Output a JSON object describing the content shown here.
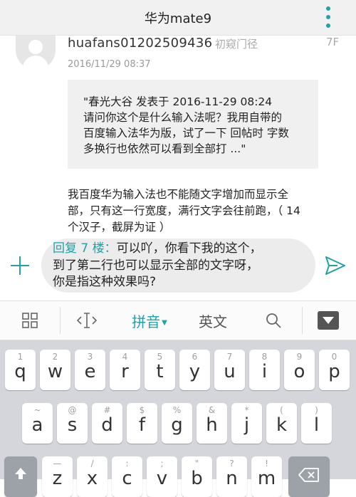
{
  "header": {
    "title": "华为mate9"
  },
  "post": {
    "username": "huafans01202509436",
    "user_level": "初窥门径",
    "floor": "7F",
    "datetime": "2016/11/29 08:37",
    "quote_lines": [
      "\"春光大谷 发表于 2016-11-29 08:24",
      "请问你这个是什么输入法呢？我用自带的",
      "百度输入法华为版，试了一下 回帖时 字数",
      "多换行也依然可以看到全部打 ...\""
    ],
    "body_lines": [
      "我百度华为输入法也不能随文字增加而显示全",
      "部，只有这一行宽度，满行文字会往前跑，（ 14",
      "个汉子，截屏为证 ）"
    ]
  },
  "reply": {
    "prefix": "回复 7 楼：",
    "line1": "可以吖，你看下我的这个，",
    "line2": "到了第二行也可以显示全部的文字呀，",
    "line3": "你是指这种效果吗?"
  },
  "ime_toolbar": {
    "pinyin_label": "拼音",
    "english_label": "英文"
  },
  "keyboard": {
    "row1": [
      {
        "sub": "1",
        "main": "q"
      },
      {
        "sub": "2",
        "main": "w"
      },
      {
        "sub": "3",
        "main": "e"
      },
      {
        "sub": "4",
        "main": "r"
      },
      {
        "sub": "5",
        "main": "t"
      },
      {
        "sub": "6",
        "main": "y"
      },
      {
        "sub": "7",
        "main": "u"
      },
      {
        "sub": "8",
        "main": "i"
      },
      {
        "sub": "9",
        "main": "o"
      },
      {
        "sub": "0",
        "main": "p"
      }
    ],
    "row2": [
      {
        "sub": "~",
        "main": "a"
      },
      {
        "sub": "@",
        "main": "s"
      },
      {
        "sub": "#",
        "main": "d"
      },
      {
        "sub": "$",
        "main": "f"
      },
      {
        "sub": "%",
        "main": "g"
      },
      {
        "sub": "&",
        "main": "h"
      },
      {
        "sub": "*",
        "main": "j"
      },
      {
        "sub": "(",
        "main": "k"
      },
      {
        "sub": ")",
        "main": "l"
      }
    ],
    "row3": [
      {
        "sub": "—",
        "main": "z"
      },
      {
        "sub": "/",
        "main": "x"
      },
      {
        "sub": ":",
        "main": "c"
      },
      {
        "sub": ";",
        "main": "v"
      },
      {
        "sub": "\"",
        "main": "b"
      },
      {
        "sub": "?",
        "main": "n"
      },
      {
        "sub": "!",
        "main": "m"
      }
    ]
  },
  "colors": {
    "accent": "#1fa2a8",
    "quote_bg": "#f0f0f0",
    "reply_bg": "#ececec",
    "keyboard_bg": "#d4d6db"
  }
}
